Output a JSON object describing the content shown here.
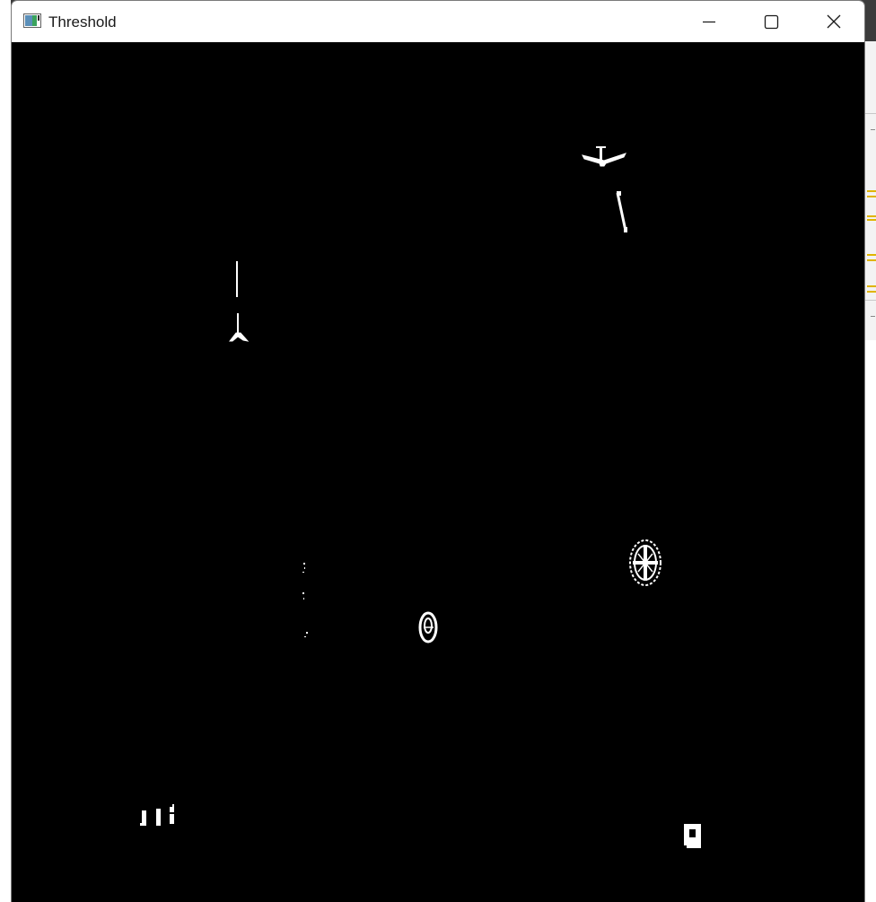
{
  "window": {
    "title": "Threshold",
    "icon": "opencv-window-icon",
    "controls": {
      "minimize": "minimize-icon",
      "maximize": "maximize-icon",
      "close": "close-icon"
    }
  },
  "image": {
    "description_colors": {
      "background": "#000000",
      "foreground": "#ffffff"
    }
  },
  "colors": {
    "titlebar": "#ffffff",
    "title_text": "#1a1a1a",
    "background_app_accent": "#e0b400"
  }
}
